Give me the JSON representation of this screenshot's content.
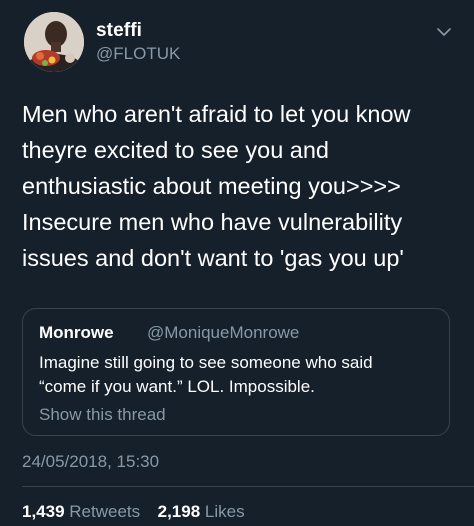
{
  "author": {
    "display_name": "steffi",
    "handle": "@FLOTUK",
    "avatar_icon": "profile-photo"
  },
  "menu_icon": "chevron-down-icon",
  "tweet": {
    "text": "Men who aren't afraid to let you know\ntheyre excited to see you and\nenthusiastic about meeting you>>>>\nInsecure men who have vulnerability\nissues and don't want to 'gas you up'"
  },
  "quoted_tweet": {
    "display_name": "Monrowe",
    "handle": "@MoniqueMonrowe",
    "text": "Imagine still going to see someone who said\n“come if you want.” LOL. Impossible.",
    "show_thread": "Show this thread"
  },
  "timestamp": "24/05/2018, 15:30",
  "stats": {
    "retweets_count": "1,439",
    "retweets_label": "Retweets",
    "likes_count": "2,198",
    "likes_label": "Likes"
  },
  "colors": {
    "background": "#15202b",
    "secondary_text": "#8899a6",
    "border": "#38444d"
  }
}
